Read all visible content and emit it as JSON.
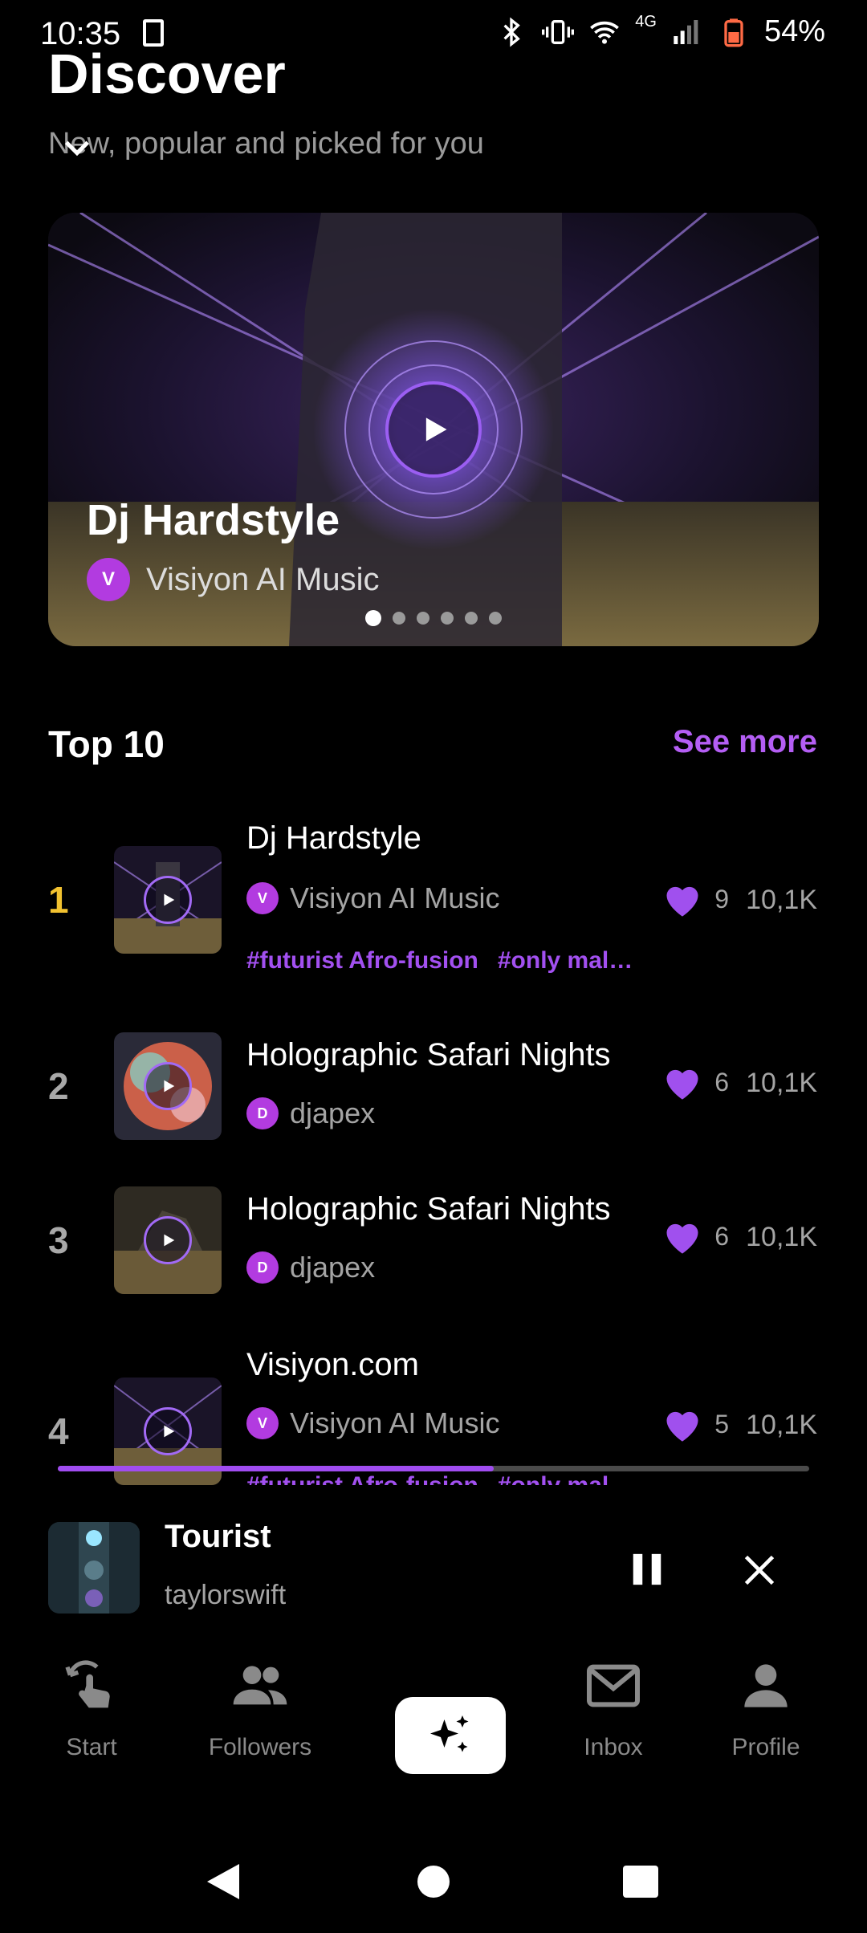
{
  "status_bar": {
    "time": "10:35",
    "network": "4G",
    "battery": "54%"
  },
  "header": {
    "title": "Discover",
    "subtitle": "New, popular and picked for you"
  },
  "hero": {
    "title": "Dj Hardstyle",
    "artist": "Visiyon AI Music",
    "artist_initial": "V",
    "slide_count": 6,
    "active_slide": 1
  },
  "top10": {
    "title": "Top 10",
    "see_more": "See more",
    "items": [
      {
        "rank": "1",
        "title": "Dj Hardstyle",
        "artist": "Visiyon AI Music",
        "artist_initial": "V",
        "tags": [
          "#futurist Afro-fusion",
          "#only mal…"
        ],
        "likes": "9",
        "plays": "10,1K"
      },
      {
        "rank": "2",
        "title": "Holographic Safari Nights",
        "artist": "djapex",
        "artist_initial": "D",
        "tags": [],
        "likes": "6",
        "plays": "10,1K"
      },
      {
        "rank": "3",
        "title": "Holographic Safari Nights",
        "artist": "djapex",
        "artist_initial": "D",
        "tags": [],
        "likes": "6",
        "plays": "10,1K"
      },
      {
        "rank": "4",
        "title": "Visiyon.com",
        "artist": "Visiyon AI Music",
        "artist_initial": "V",
        "tags": [
          "#futurist Afro-fusion",
          "#only mal…"
        ],
        "likes": "5",
        "plays": "10,1K"
      }
    ]
  },
  "player": {
    "title": "Tourist",
    "artist": "taylorswift",
    "progress": 0.58
  },
  "nav": {
    "items": [
      "Start",
      "Followers",
      "Inbox",
      "Profile"
    ]
  },
  "colors": {
    "accent": "#b45ef4",
    "tag": "#a250f0",
    "heart": "#a050ee",
    "gold_rank": "#f2c230",
    "avatar": "#b23be0"
  }
}
